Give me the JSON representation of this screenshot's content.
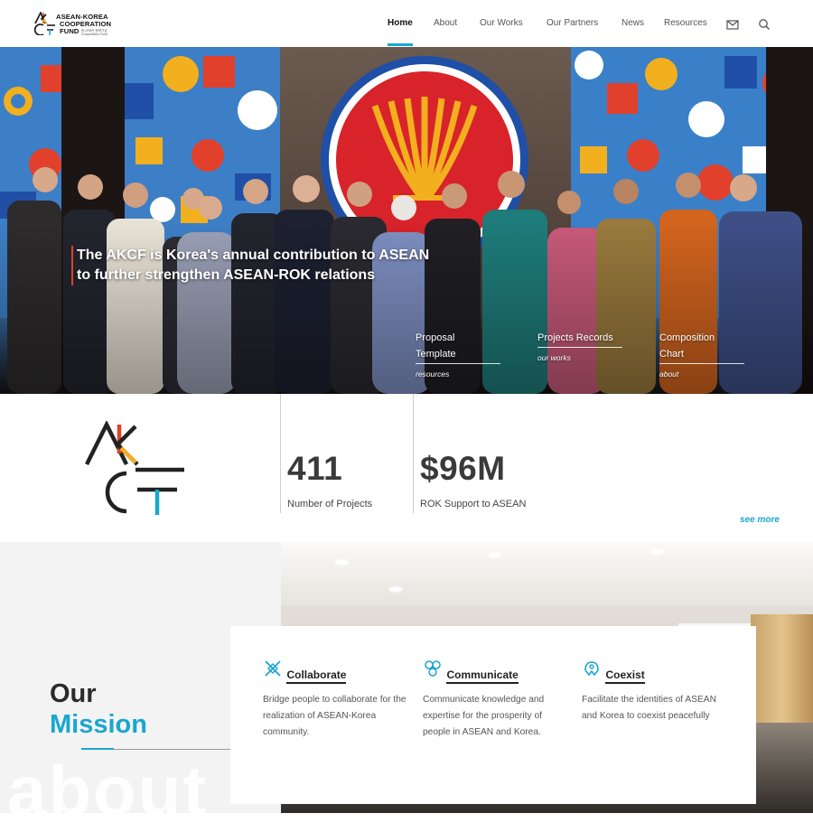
{
  "header": {
    "logo_text": [
      "ASEAN-KOREA",
      "COOPERATION",
      "FUND"
    ],
    "logo_sub": "한-아세안 협력기금 Cooperation Fund",
    "nav": [
      {
        "label": "Home",
        "active": true
      },
      {
        "label": "About",
        "active": false
      },
      {
        "label": "Our Works",
        "active": false
      },
      {
        "label": "Our Partners",
        "active": false
      },
      {
        "label": "News",
        "active": false
      },
      {
        "label": "Resources",
        "active": false
      }
    ],
    "icons": [
      "mail-icon",
      "search-icon"
    ],
    "accent_color": "#1aa6d0"
  },
  "hero": {
    "tagline_line1": "The AKCF is Korea's annual contribution to ASEAN",
    "tagline_line2": "to further strengthen ASEAN-ROK relations",
    "quick_links": [
      {
        "label_line1": "Proposal",
        "label_line2": "Template",
        "sub": "resources"
      },
      {
        "label_line1": "Projects Records",
        "label_line2": "",
        "sub": "our works"
      },
      {
        "label_line1": "Composition",
        "label_line2": "Chart",
        "sub": "about"
      }
    ]
  },
  "stats": {
    "items": [
      {
        "value": "411",
        "label": "Number of Projects"
      },
      {
        "value": "$96M",
        "label": "ROK Support to ASEAN"
      }
    ],
    "see_more": "see more"
  },
  "mission": {
    "title_line1": "Our",
    "title_line2": "Mission",
    "ghost_text": "about",
    "pillars": [
      {
        "icon": "collaborate-icon",
        "title": "Collaborate",
        "desc": "Bridge people to collaborate for the realization of ASEAN-Korea community."
      },
      {
        "icon": "communicate-icon",
        "title": "Communicate",
        "desc": "Communicate knowledge and expertise for the prosperity of people in ASEAN and Korea."
      },
      {
        "icon": "coexist-icon",
        "title": "Coexist",
        "desc": "Facilitate the identities of ASEAN and Korea to coexist peacefully"
      }
    ]
  }
}
